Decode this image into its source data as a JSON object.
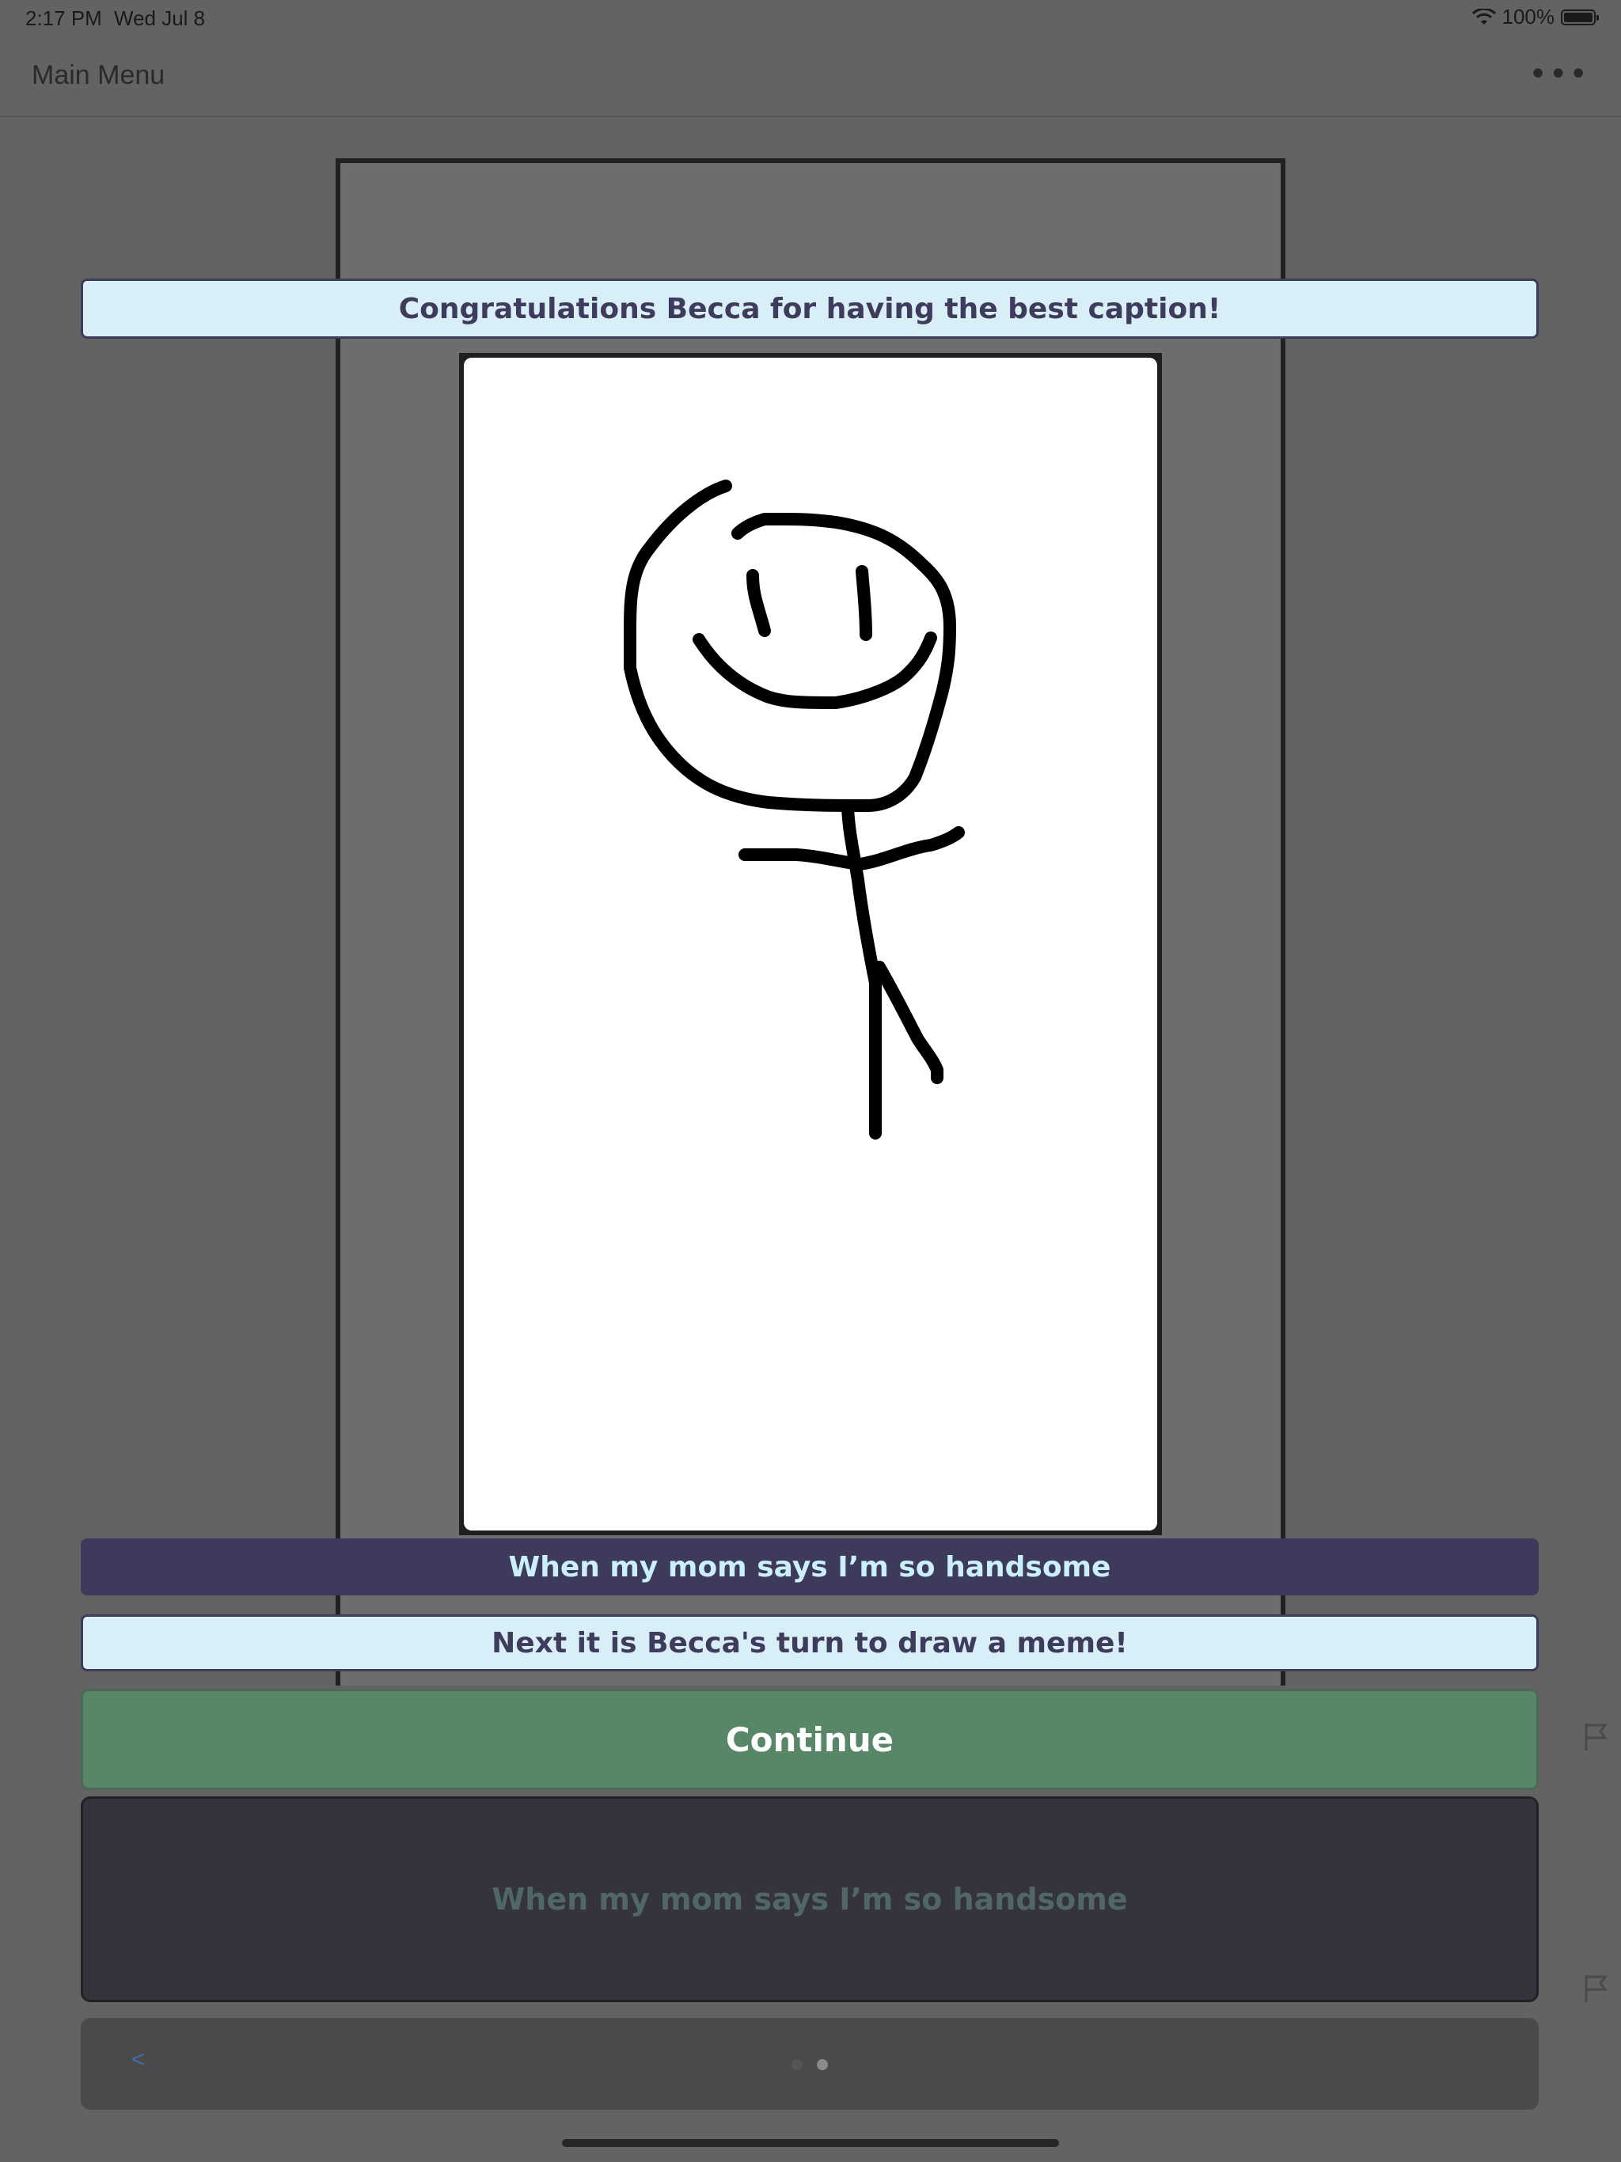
{
  "status_bar": {
    "time": "2:17 PM",
    "date": "Wed Jul 8",
    "battery_percent": "100%",
    "wifi_icon": "wifi-icon",
    "battery_icon": "battery-icon"
  },
  "nav": {
    "title": "Main Menu",
    "more_icon": "ellipsis-icon",
    "more_glyph": "•••"
  },
  "banners": {
    "congrats": "Congratulations Becca for having the best caption!",
    "caption": "When my mom says I’m so handsome",
    "next_turn": "Next it is Becca's turn to draw a meme!"
  },
  "continue_label": "Continue",
  "caption_panel_text": "When my mom says I’m so handsome",
  "pager": {
    "prev_label": "<",
    "page_count": 2,
    "current_page": 2
  },
  "colors": {
    "background": "#636363",
    "banner_light": "#d8eff8",
    "banner_dark": "#3e3a5c",
    "continue_green": "#578766",
    "panel_dark": "#35343d"
  }
}
